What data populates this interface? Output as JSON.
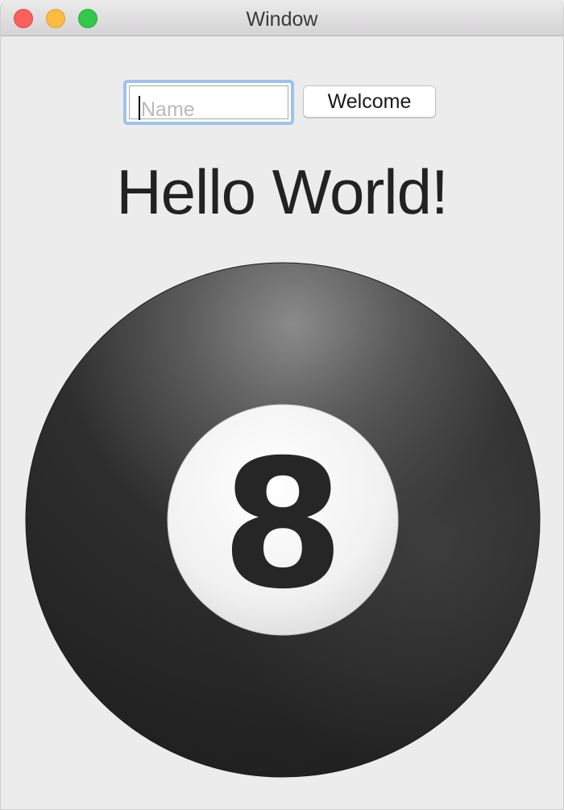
{
  "window": {
    "title": "Window"
  },
  "name_field": {
    "placeholder": "Name",
    "value": ""
  },
  "welcome_button": {
    "label": "Welcome"
  },
  "greeting": {
    "text": "Hello World!"
  },
  "ball": {
    "number": "8",
    "icon": "eight-ball-icon"
  },
  "colors": {
    "close": "#fc605c",
    "minimize": "#fdbc40",
    "maximize": "#34c84a",
    "focus_ring": "#9ec2ef"
  }
}
